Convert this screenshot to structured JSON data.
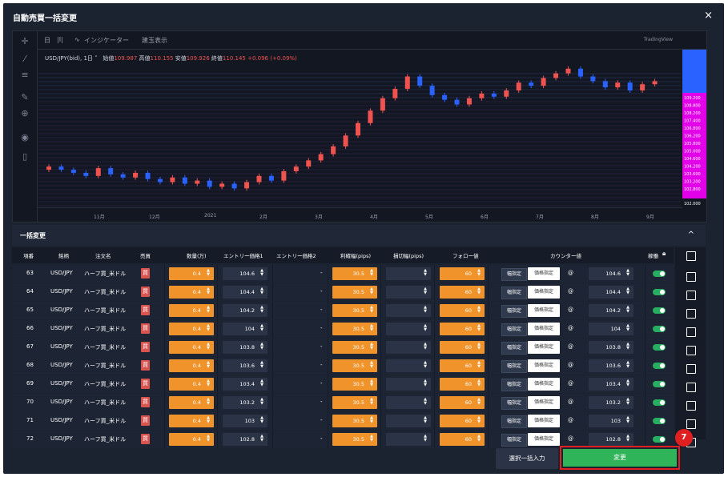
{
  "window": {
    "title": "自動売買一括変更",
    "close_symbol": "×"
  },
  "chart_toolbar": {
    "interval": "日",
    "bar_style_symbol": "|Ⅰ|",
    "indicators": "インジケーター",
    "positions": "建玉表示",
    "brand": "TradingView"
  },
  "chart_quote": {
    "symbol": "USD/JPY(bid), 1日",
    "open_label": "始値",
    "open": "109.987",
    "high_label": "高値",
    "high": "110.155",
    "low_label": "安値",
    "low": "109.926",
    "close_label": "終値",
    "close": "110.145",
    "change": "+0.096 (+0.09%)"
  },
  "chart_data": {
    "type": "candlestick",
    "x_labels": [
      "11月",
      "12月",
      "2021",
      "2月",
      "3月",
      "4月",
      "5月",
      "6月",
      "7月",
      "8月",
      "9月"
    ],
    "y_labels": [
      "109.200",
      "108.800",
      "108.200",
      "107.400",
      "106.800",
      "106.200",
      "105.800",
      "105.000",
      "104.600",
      "104.200",
      "103.600",
      "103.200",
      "102.800",
      "102.000"
    ],
    "close_series": [
      104.6,
      104.4,
      104.2,
      104.0,
      104.5,
      104.1,
      103.9,
      104.2,
      103.8,
      103.6,
      103.9,
      103.5,
      103.7,
      103.3,
      103.5,
      103.2,
      103.6,
      104.0,
      103.7,
      104.3,
      104.6,
      105.0,
      105.4,
      105.9,
      106.6,
      107.4,
      108.2,
      109.0,
      109.6,
      110.4,
      109.8,
      109.2,
      108.9,
      108.6,
      109.0,
      109.3,
      109.1,
      109.5,
      110.0,
      109.8,
      110.3,
      110.6,
      110.9,
      110.4,
      110.1,
      109.7,
      110.0,
      109.5,
      109.9,
      110.1
    ],
    "colors": {
      "up": "#ef5350",
      "down": "#2962ff"
    },
    "bands": {
      "blue": "#2962ff",
      "magenta": "#e100e8"
    }
  },
  "bulk": {
    "title": "一括変更",
    "collapse_symbol": "^"
  },
  "table": {
    "headers": {
      "no": "項番",
      "symbol": "銘柄",
      "order": "注文名",
      "side": "売買",
      "qty": "数量(万)",
      "entry1": "エントリー価格1",
      "entry2": "エントリー価格2",
      "tp": "利確幅(pips)",
      "sl": "損切幅(pips)",
      "follow": "フォロー値",
      "counter": "カウンター値",
      "active": "稼働"
    },
    "rows": [
      {
        "no": "63",
        "symbol": "USD/JPY",
        "order": "ハーフ買_米ドル",
        "side": "買",
        "qty": "0.4",
        "entry1": "104.6",
        "entry2": "-",
        "tp": "30.5",
        "sl": "",
        "follow": "60",
        "w": "幅指定",
        "p": "価格指定",
        "at": "@",
        "counter": "104.6"
      },
      {
        "no": "64",
        "symbol": "USD/JPY",
        "order": "ハーフ買_米ドル",
        "side": "買",
        "qty": "0.4",
        "entry1": "104.4",
        "entry2": "-",
        "tp": "30.5",
        "sl": "",
        "follow": "60",
        "w": "幅指定",
        "p": "価格指定",
        "at": "@",
        "counter": "104.4"
      },
      {
        "no": "65",
        "symbol": "USD/JPY",
        "order": "ハーフ買_米ドル",
        "side": "買",
        "qty": "0.4",
        "entry1": "104.2",
        "entry2": "-",
        "tp": "30.5",
        "sl": "",
        "follow": "60",
        "w": "幅指定",
        "p": "価格指定",
        "at": "@",
        "counter": "104.2"
      },
      {
        "no": "66",
        "symbol": "USD/JPY",
        "order": "ハーフ買_米ドル",
        "side": "買",
        "qty": "0.4",
        "entry1": "104",
        "entry2": "-",
        "tp": "30.5",
        "sl": "",
        "follow": "60",
        "w": "幅指定",
        "p": "価格指定",
        "at": "@",
        "counter": "104"
      },
      {
        "no": "67",
        "symbol": "USD/JPY",
        "order": "ハーフ買_米ドル",
        "side": "買",
        "qty": "0.4",
        "entry1": "103.8",
        "entry2": "-",
        "tp": "30.5",
        "sl": "",
        "follow": "60",
        "w": "幅指定",
        "p": "価格指定",
        "at": "@",
        "counter": "103.8"
      },
      {
        "no": "68",
        "symbol": "USD/JPY",
        "order": "ハーフ買_米ドル",
        "side": "買",
        "qty": "0.4",
        "entry1": "103.6",
        "entry2": "-",
        "tp": "30.5",
        "sl": "",
        "follow": "60",
        "w": "幅指定",
        "p": "価格指定",
        "at": "@",
        "counter": "103.6"
      },
      {
        "no": "69",
        "symbol": "USD/JPY",
        "order": "ハーフ買_米ドル",
        "side": "買",
        "qty": "0.4",
        "entry1": "103.4",
        "entry2": "-",
        "tp": "30.5",
        "sl": "",
        "follow": "60",
        "w": "幅指定",
        "p": "価格指定",
        "at": "@",
        "counter": "103.4"
      },
      {
        "no": "70",
        "symbol": "USD/JPY",
        "order": "ハーフ買_米ドル",
        "side": "買",
        "qty": "0.4",
        "entry1": "103.2",
        "entry2": "-",
        "tp": "30.5",
        "sl": "",
        "follow": "60",
        "w": "幅指定",
        "p": "価格指定",
        "at": "@",
        "counter": "103.2"
      },
      {
        "no": "71",
        "symbol": "USD/JPY",
        "order": "ハーフ買_米ドル",
        "side": "買",
        "qty": "0.4",
        "entry1": "103",
        "entry2": "-",
        "tp": "30.5",
        "sl": "",
        "follow": "60",
        "w": "幅指定",
        "p": "価格指定",
        "at": "@",
        "counter": "103"
      },
      {
        "no": "72",
        "symbol": "USD/JPY",
        "order": "ハーフ買_米ドル",
        "side": "買",
        "qty": "0.4",
        "entry1": "102.8",
        "entry2": "-",
        "tp": "30.5",
        "sl": "",
        "follow": "60",
        "w": "幅指定",
        "p": "価格指定",
        "at": "@",
        "counter": "102.8"
      }
    ]
  },
  "footer": {
    "bulk_input": "選択一括入力",
    "change": "変更",
    "step_badge": "7"
  }
}
